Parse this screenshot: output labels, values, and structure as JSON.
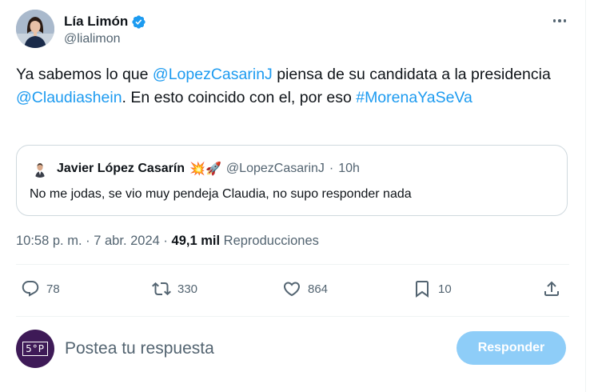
{
  "author": {
    "name": "Lía Limón",
    "handle": "@lialimon"
  },
  "tweet": {
    "segments": [
      {
        "text": "Ya sabemos lo que ",
        "type": "text"
      },
      {
        "text": "@LopezCasarinJ",
        "type": "mention"
      },
      {
        "text": " piensa de su candidata a la presidencia ",
        "type": "text"
      },
      {
        "text": "@Claudiashein",
        "type": "mention"
      },
      {
        "text": ". En esto coincido con el, por eso ",
        "type": "text"
      },
      {
        "text": "#MorenaYaSeVa",
        "type": "hashtag"
      }
    ]
  },
  "quote": {
    "name": "Javier López Casarín",
    "emojis": "💥🚀",
    "handle": "@LopezCasarinJ",
    "separator": "·",
    "time": "10h",
    "text": "No me jodas, se vio muy pendeja Claudia, no supo responder nada"
  },
  "meta": {
    "time": "10:58 p. m.",
    "sep1": "·",
    "date": "7 abr. 2024",
    "sep2": "·",
    "views_count": "49,1 mil",
    "views_label": "Reproducciones"
  },
  "actions": {
    "replies": "78",
    "reposts": "330",
    "likes": "864",
    "bookmarks": "10"
  },
  "reply": {
    "avatar_text": "5°P",
    "placeholder": "Postea tu respuesta",
    "button_label": "Responder"
  },
  "colors": {
    "link": "#1d9bf0",
    "secondary_text": "#536471",
    "primary_text": "#0f1419",
    "button_disabled": "#8ecdf8",
    "border": "#cfd9de",
    "divider": "#eff3f4"
  },
  "icons": {
    "verified": "verified-badge-icon",
    "more": "more-icon",
    "reply": "reply-icon",
    "repost": "repost-icon",
    "like": "heart-icon",
    "bookmark": "bookmark-icon",
    "share": "share-icon"
  }
}
